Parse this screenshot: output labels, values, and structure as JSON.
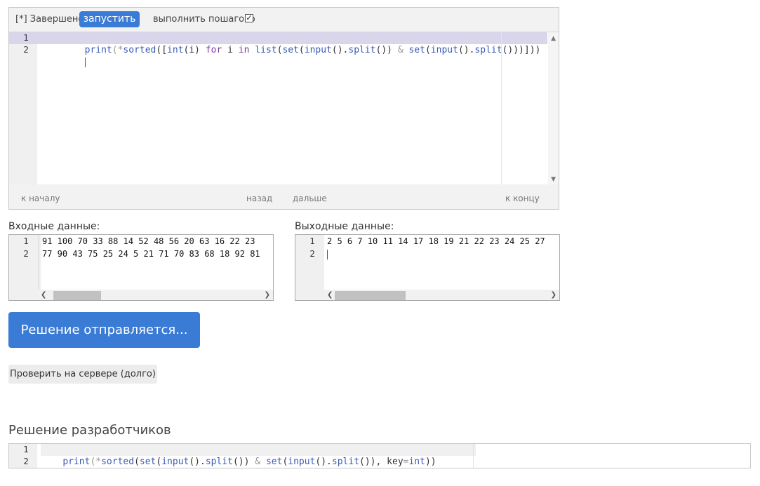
{
  "toolbar": {
    "status": "[*] Завершено",
    "run_label": "запустить",
    "step_label": "выполнить пошагово",
    "step_checked": "✓"
  },
  "editor": {
    "line_numbers": [
      "1",
      "2"
    ],
    "line1_tokens": [
      "print",
      "(*",
      "sorted",
      "([",
      "int",
      "(i)",
      " for ",
      "i",
      " in ",
      "list",
      "(",
      "set",
      "(",
      "input",
      "().",
      "split",
      "())",
      " & ",
      "set",
      "(",
      "input",
      "().",
      "split",
      "()))]))"
    ]
  },
  "nav": {
    "start": "к началу",
    "back": "назад",
    "forward": "дальше",
    "end": "к концу"
  },
  "input": {
    "label": "Входные данные:",
    "line_numbers": [
      "1",
      "2"
    ],
    "lines": [
      "91 100 70 33 88 14 52 48 56 20 63 16 22 23",
      "77 90 43 75 25 24 5 21 71 70 83 68 18 92 81"
    ]
  },
  "output": {
    "label": "Выходные данные:",
    "line_numbers": [
      "1",
      "2"
    ],
    "lines": [
      "2 5 6 7 10 11 14 17 18 19 21 22 23 24 25 27",
      ""
    ]
  },
  "buttons": {
    "submit": "Решение отправляется...",
    "check_server": "Проверить на сервере (долго)"
  },
  "developer": {
    "title": "Решение разработчиков",
    "line_numbers": [
      "1",
      "2"
    ],
    "line1_tokens": [
      "print",
      "(*",
      "sorted",
      "(",
      "set",
      "(",
      "input",
      "().",
      "split",
      "())",
      " & ",
      "set",
      "(",
      "input",
      "().",
      "split",
      "()),",
      " key",
      "=",
      "int",
      "))"
    ]
  },
  "colors": {
    "accent": "#3a7bd5",
    "active_line": "#d9d6ec",
    "keyword": "#7a3e9d",
    "builtin": "#3b5bb5"
  }
}
